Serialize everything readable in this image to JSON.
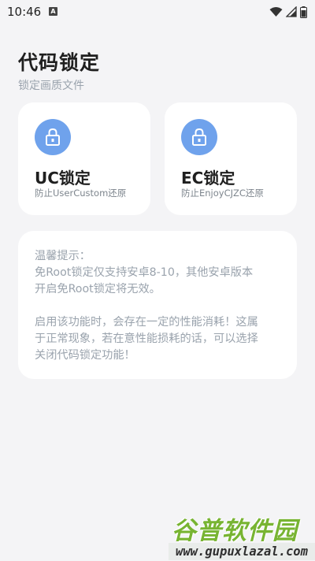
{
  "status_bar": {
    "time": "10:46",
    "notification_icon": "a-letter-icon",
    "icons": [
      "wifi-icon",
      "signal-icon",
      "battery-icon"
    ]
  },
  "header": {
    "title": "代码锁定",
    "subtitle": "锁定画质文件"
  },
  "cards": [
    {
      "icon": "lock-icon",
      "title": "UC锁定",
      "description": "防止UserCustom还原"
    },
    {
      "icon": "lock-icon",
      "title": "EC锁定",
      "description": "防止EnjoyCJZC还原"
    }
  ],
  "tips": {
    "text": "温馨提示：\n免Root锁定仅支持安卓8-10，其他安卓版本\n开启免Root锁定将无效。\n\n启用该功能时，会存在一定的性能消耗！这属\n于正常现象，若在意性能损耗的话，可以选择\n关闭代码锁定功能！"
  },
  "watermark": {
    "brand": "谷普软件园",
    "url": "www.gupuxlazal.com"
  },
  "colors": {
    "accent": "#6fa2ec",
    "background": "#f4f4f6",
    "card": "#ffffff",
    "muted_text": "#9aa3ad"
  }
}
